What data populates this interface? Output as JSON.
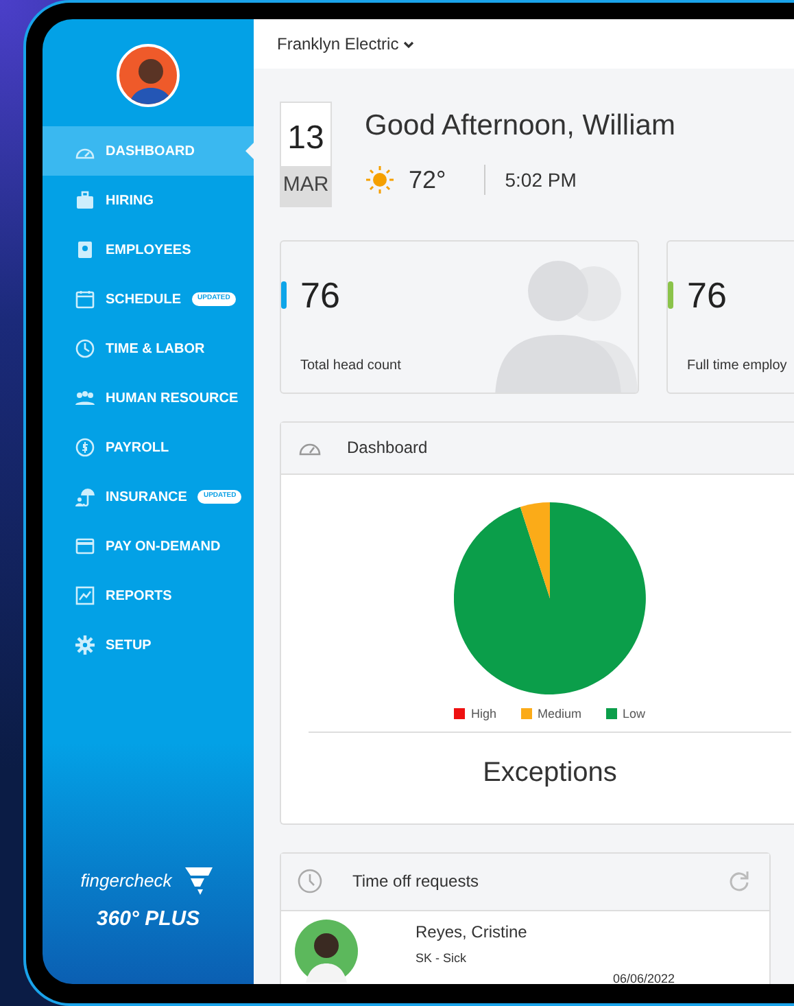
{
  "topbar": {
    "company": "Franklyn Electric"
  },
  "sidebar": {
    "items": [
      {
        "label": "DASHBOARD",
        "selected": true
      },
      {
        "label": "HIRING",
        "selected": false
      },
      {
        "label": "EMPLOYEES",
        "selected": false
      },
      {
        "label": "SCHEDULE",
        "selected": false,
        "badge": "UPDATED"
      },
      {
        "label": "TIME & LABOR",
        "selected": false
      },
      {
        "label": "HUMAN RESOURCE",
        "selected": false
      },
      {
        "label": "PAYROLL",
        "selected": false
      },
      {
        "label": "INSURANCE",
        "selected": false,
        "badge": "UPDATED"
      },
      {
        "label": "PAY ON-DEMAND",
        "selected": false
      },
      {
        "label": "REPORTS",
        "selected": false
      },
      {
        "label": "SETUP",
        "selected": false
      }
    ],
    "brand": "fingercheck",
    "edition": "360° PLUS"
  },
  "greeting": {
    "day": "13",
    "month": "MAR",
    "text": "Good Afternoon, William",
    "temperature": "72°",
    "time": "5:02 PM"
  },
  "stats": [
    {
      "value": "76",
      "label": "Total head count",
      "color": "#0ea5e9"
    },
    {
      "value": "76",
      "label": "Full time employ",
      "color": "#8bc34a"
    }
  ],
  "dashboard_panel": {
    "title": "Dashboard",
    "legend": [
      {
        "label": "High",
        "color": "#ee1111"
      },
      {
        "label": "Medium",
        "color": "#fbab18"
      },
      {
        "label": "Low",
        "color": "#0b9e4a"
      }
    ],
    "caption": "Exceptions"
  },
  "time_off": {
    "title": "Time off requests",
    "requests": [
      {
        "name": "Reyes, Cristine",
        "type": "SK - Sick",
        "date": "06/06/2022"
      }
    ]
  }
}
